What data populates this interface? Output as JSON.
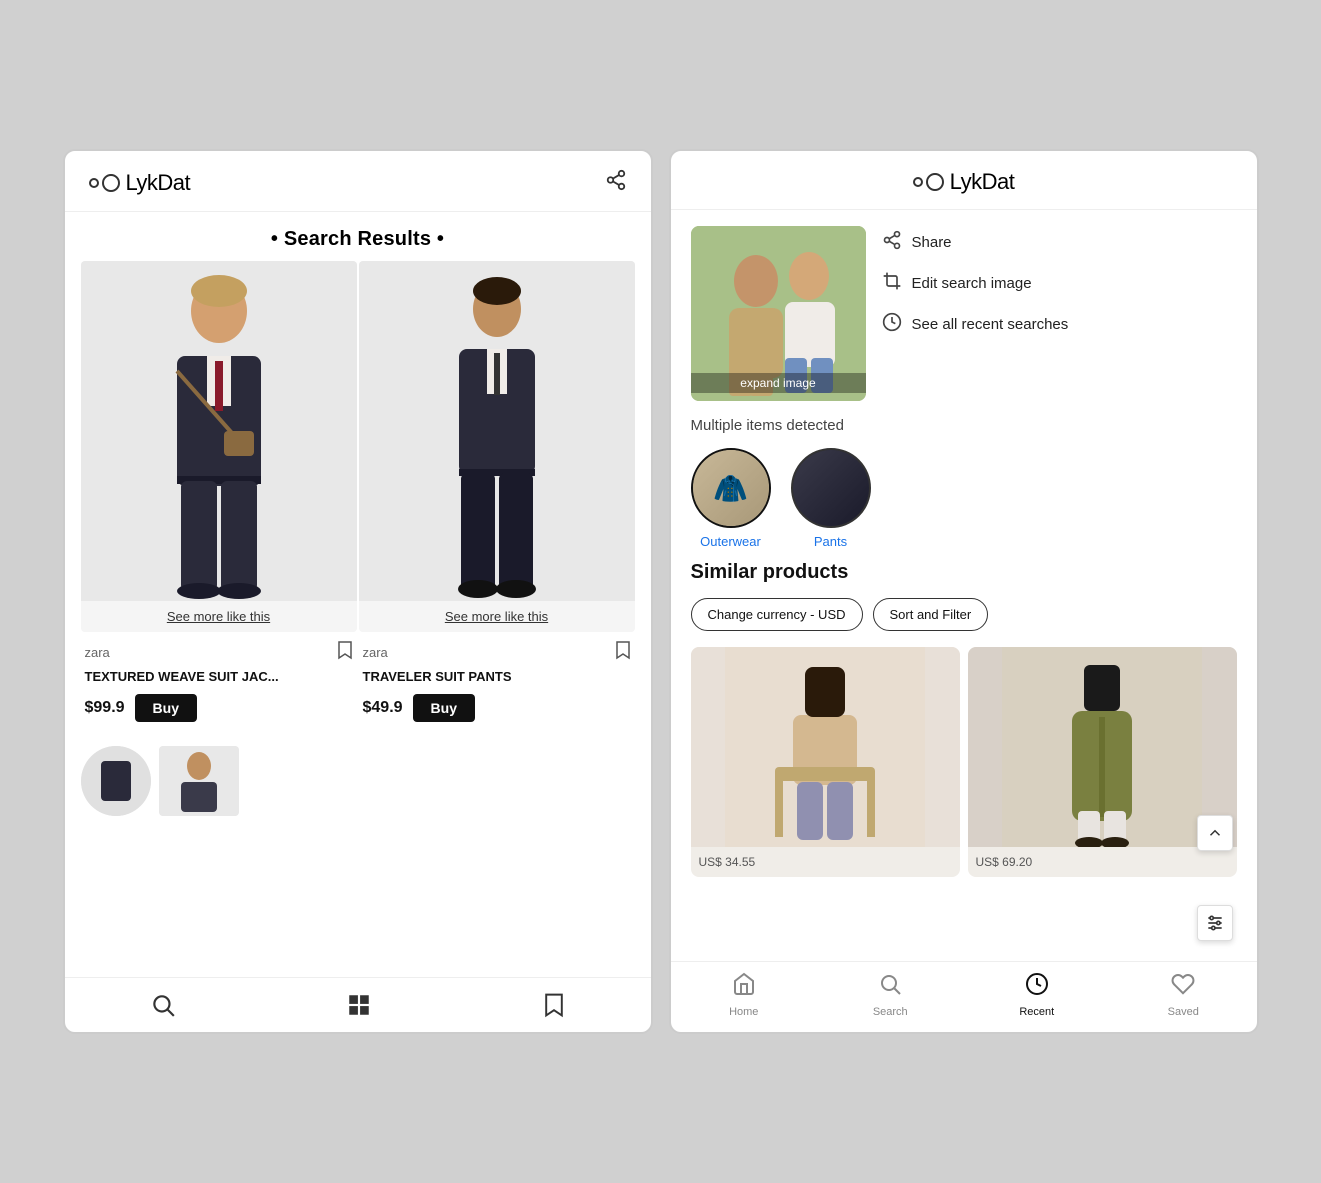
{
  "app": {
    "name": "LykDat"
  },
  "left_screen": {
    "header": {
      "share_label": "share"
    },
    "title": "Search Results",
    "products": [
      {
        "brand": "zara",
        "title": "TEXTURED WEAVE SUIT JAC...",
        "price": "$99.9",
        "buy_label": "Buy",
        "see_more_label": "See more like this"
      },
      {
        "brand": "zara",
        "title": "TRAVELER SUIT PANTS",
        "price": "$49.9",
        "buy_label": "Buy",
        "see_more_label": "See more like this"
      }
    ],
    "bottom_nav": {
      "search_icon": "🔍",
      "grid_icon": "⊞",
      "bookmark_icon": "🔖"
    }
  },
  "right_screen": {
    "expand_image_label": "expand image",
    "actions": [
      {
        "label": "Share",
        "icon": "share"
      },
      {
        "label": "Edit search image",
        "icon": "crop"
      },
      {
        "label": "See all recent searches",
        "icon": "clock"
      }
    ],
    "multiple_items_label": "Multiple items detected",
    "detected_items": [
      {
        "label": "Outerwear"
      },
      {
        "label": "Pants"
      }
    ],
    "similar_products_label": "Similar products",
    "filters": [
      {
        "label": "Change currency - USD"
      },
      {
        "label": "Sort and Filter"
      }
    ],
    "similar_products": [
      {
        "price": "US$ 34.55"
      },
      {
        "price": "US$ 69.20"
      }
    ],
    "bottom_nav": {
      "tabs": [
        {
          "label": "Home",
          "icon": "home",
          "active": false
        },
        {
          "label": "Search",
          "icon": "search",
          "active": false
        },
        {
          "label": "Recent",
          "icon": "clock",
          "active": true
        },
        {
          "label": "Saved",
          "icon": "heart",
          "active": false
        }
      ]
    }
  }
}
